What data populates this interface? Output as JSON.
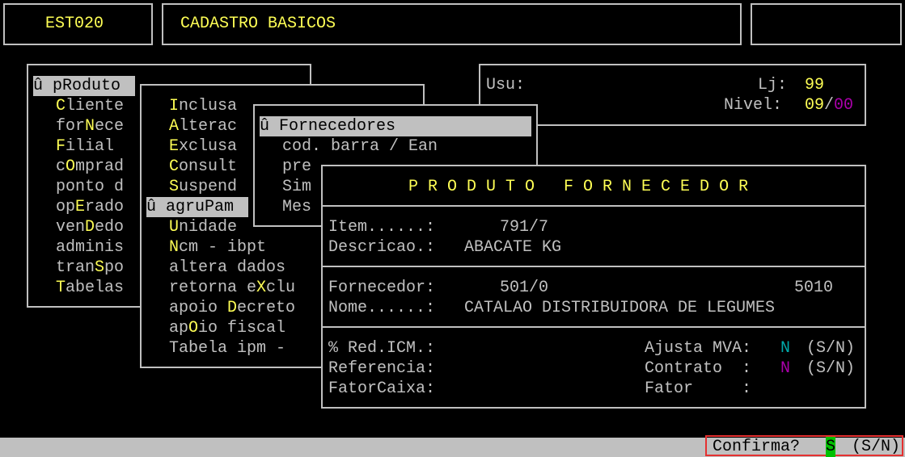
{
  "header": {
    "program_code": "EST020",
    "title": "CADASTRO BASICOS",
    "right_box": ""
  },
  "info": {
    "usu_label": "Usu:",
    "lj_label": "Lj:",
    "lj_value": "99",
    "nivel_label": "Nivel:",
    "nivel_value_a": "09",
    "nivel_sep": "/",
    "nivel_value_b": "00"
  },
  "menu1": {
    "items": [
      {
        "pre": "û p",
        "hot": "R",
        "post": "oduto",
        "selected": true
      },
      {
        "pre": "",
        "hot": "C",
        "post": "liente"
      },
      {
        "pre": "for",
        "hot": "N",
        "post": "ece"
      },
      {
        "pre": "",
        "hot": "F",
        "post": "ilial"
      },
      {
        "pre": "c",
        "hot": "O",
        "post": "mprad"
      },
      {
        "pre": "ponto d",
        "hot": "",
        "post": ""
      },
      {
        "pre": "op",
        "hot": "E",
        "post": "rado"
      },
      {
        "pre": "ven",
        "hot": "D",
        "post": "edo"
      },
      {
        "pre": "adminis",
        "hot": "",
        "post": ""
      },
      {
        "pre": "tran",
        "hot": "S",
        "post": "po"
      },
      {
        "pre": "",
        "hot": "T",
        "post": "abelas"
      }
    ]
  },
  "menu2": {
    "items": [
      {
        "pre": "",
        "hot": "I",
        "post": "nclusa"
      },
      {
        "pre": "",
        "hot": "A",
        "post": "lterac"
      },
      {
        "pre": "",
        "hot": "E",
        "post": "xclusa"
      },
      {
        "pre": "",
        "hot": "C",
        "post": "onsult"
      },
      {
        "pre": "",
        "hot": "S",
        "post": "uspend"
      },
      {
        "pre": "û agru",
        "hot": "P",
        "post": "am",
        "selected": true
      },
      {
        "pre": "",
        "hot": "U",
        "post": "nidade"
      },
      {
        "pre": "",
        "hot": "N",
        "post": "cm - ibpt"
      },
      {
        "pre": "altera dados",
        "hot": "",
        "post": ""
      },
      {
        "pre": "retorna e",
        "hot": "X",
        "post": "clu"
      },
      {
        "pre": "apoio ",
        "hot": "D",
        "post": "ecreto"
      },
      {
        "pre": "ap",
        "hot": "O",
        "post": "io fiscal"
      },
      {
        "pre": "Tabela ipm -",
        "hot": "",
        "post": ""
      }
    ]
  },
  "menu3": {
    "items": [
      {
        "pre": "û Fornecedores",
        "hot": "",
        "post": "",
        "selected": true
      },
      {
        "pre": "cod. barra / Ean",
        "hot": "",
        "post": ""
      },
      {
        "pre": "pre",
        "hot": "",
        "post": ""
      },
      {
        "pre": "Sim",
        "hot": "",
        "post": ""
      },
      {
        "pre": "Mes",
        "hot": "",
        "post": ""
      }
    ]
  },
  "dialog": {
    "title": "P R O D U T O   F O R N E C E D O R",
    "item_label": "Item......:",
    "item_value": "791/7",
    "descricao_label": "Descricao.:",
    "descricao_value": "ABACATE KG",
    "fornecedor_label": "Fornecedor:",
    "fornecedor_value": "501/0",
    "fornecedor_code": "5010",
    "nome_label": "Nome......:",
    "nome_value": "CATALAO DISTRIBUIDORA DE LEGUMES",
    "red_icm_label": "% Red.ICM.:",
    "referencia_label": "Referencia:",
    "fatorcaixa_label": "FatorCaixa:",
    "ajusta_mva_label": "Ajusta MVA:",
    "ajusta_mva_value": "N",
    "sn_hint": "(S/N)",
    "contrato_label": "Contrato  :",
    "contrato_value": "N",
    "fator_label": "Fator     :"
  },
  "status": {
    "confirm_label": "Confirma?",
    "confirm_value": "S",
    "confirm_hint": "(S/N)"
  },
  "colors": {
    "highlight": "#ffff55",
    "border": "#c0c0c0",
    "cyan": "#00aaaa",
    "magenta": "#aa00aa",
    "confirm_value_bg": "#00c000",
    "confirm_border": "#e53030"
  }
}
